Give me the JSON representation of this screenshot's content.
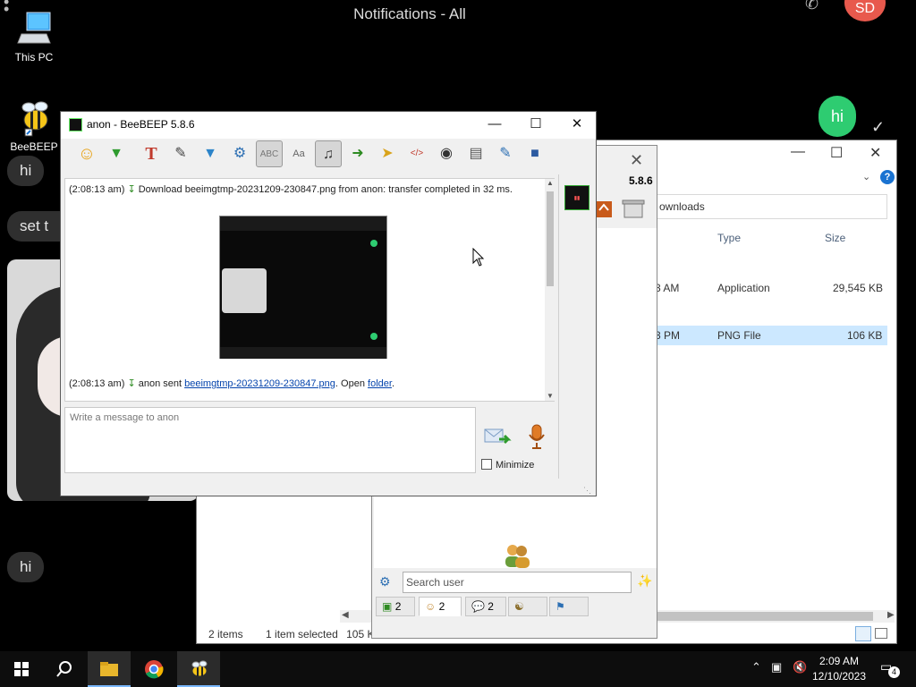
{
  "background_app": {
    "header_title": "Notifications - All",
    "avatar_initials": "SD",
    "bubble_hi_left": "hi",
    "bubble_set_partial": "set t",
    "bubble_hi_bottom": "hi",
    "bubble_hi_green": "hi"
  },
  "desktop": {
    "icons": [
      {
        "label": "This PC"
      },
      {
        "label": "BeeBEEP"
      }
    ]
  },
  "explorer": {
    "address_partial": "ownloads",
    "columns": {
      "type": "Type",
      "size": "Size"
    },
    "rows": [
      {
        "time_partial": "3 AM",
        "type": "Application",
        "size": "29,545 KB",
        "selected": false
      },
      {
        "time_partial": "3 PM",
        "type": "PNG File",
        "size": "106 KB",
        "selected": true
      }
    ],
    "status": {
      "items": "2 items",
      "selected": "1 item selected",
      "size": "105 KB"
    }
  },
  "userlist": {
    "version": "5.8.6",
    "search_placeholder": "Search user",
    "tabs": [
      {
        "icon": "chat-icon",
        "count": "2"
      },
      {
        "icon": "users-icon",
        "count": "2"
      },
      {
        "icon": "conversations-icon",
        "count": "2"
      },
      {
        "icon": "groups-icon",
        "count": ""
      },
      {
        "icon": "network-icon",
        "count": ""
      }
    ]
  },
  "chat": {
    "title": "anon - BeeBEEP 5.8.6",
    "messages": {
      "first_time": "(2:08:13 am)",
      "first_text": "Download beeimgtmp-20231209-230847.png from anon: transfer completed in 32 ms.",
      "second_time": "(2:08:13 am)",
      "second_prefix": "anon sent",
      "second_link": "beeimgtmp-20231209-230847.png",
      "second_mid": ". Open",
      "second_folder": "folder",
      "second_end": "."
    },
    "input_placeholder": "Write a message to anon",
    "minimize_label": "Minimize",
    "toolbar": [
      "emoticon-icon",
      "save-icon",
      "font-icon",
      "color-icon",
      "filter-icon",
      "settings-icon",
      "spellcheck-icon",
      "dictionary-icon",
      "music-note-icon",
      "export-icon",
      "folder-send-icon",
      "html-icon",
      "screenshot-icon",
      "window-icon",
      "notes-icon",
      "floppy-icon"
    ]
  },
  "taskbar": {
    "time": "2:09 AM",
    "date": "12/10/2023",
    "notification_count": "4"
  }
}
